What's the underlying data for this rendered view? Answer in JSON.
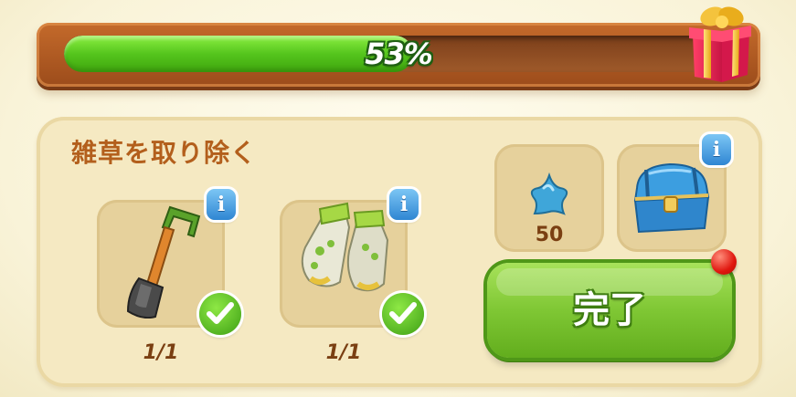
{
  "progress": {
    "percent": 53,
    "label": "53%"
  },
  "task": {
    "title": "雑草を取り除く",
    "items": [
      {
        "name": "shovel",
        "count_label": "1/1",
        "completed": true
      },
      {
        "name": "gardening-gloves",
        "count_label": "1/1",
        "completed": true
      }
    ]
  },
  "rewards": {
    "star": {
      "value": "50"
    },
    "chest": {
      "has_info": true
    }
  },
  "actions": {
    "complete_label": "完了"
  },
  "icons": {
    "info": "i"
  },
  "colors": {
    "progress_fill": "#55c51d",
    "frame": "#b35f1c",
    "button": "#7fc734",
    "info": "#2f86d3",
    "notification": "#e0170f"
  }
}
